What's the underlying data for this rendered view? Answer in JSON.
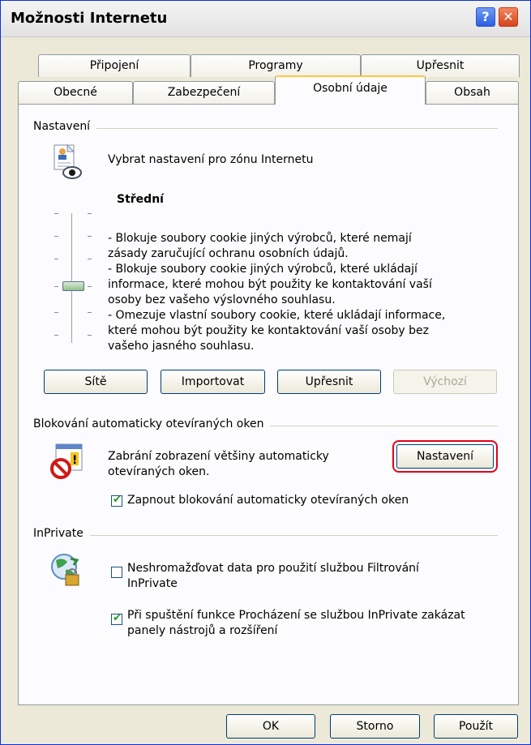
{
  "window": {
    "title": "Možnosti Internetu"
  },
  "tabs_back": [
    "Připojení",
    "Programy",
    "Upřesnit"
  ],
  "tabs_front": [
    "Obecné",
    "Zabezpečení",
    "Osobní údaje",
    "Obsah"
  ],
  "settings": {
    "group_title": "Nastavení",
    "zone_text": "Vybrat nastavení pro zónu Internetu",
    "level": "Střední",
    "desc": [
      "- Blokuje soubory cookie jiných výrobců, které nemají",
      "zásady zaručující ochranu osobních údajů.",
      "- Blokuje soubory cookie jiných výrobců, které ukládají",
      "informace, které mohou být použity ke kontaktování vaší",
      "osoby bez vašeho výslovného souhlasu.",
      "- Omezuje vlastní soubory cookie, které ukládají informace,",
      "které mohou být použity ke kontaktování vaší osoby bez",
      "vašeho jasného souhlasu."
    ],
    "buttons": [
      "Sítě",
      "Importovat",
      "Upřesnit",
      "Výchozí"
    ]
  },
  "popup": {
    "group_title": "Blokování automaticky otevíraných oken",
    "text_line1": "Zabrání zobrazení většiny automaticky",
    "text_line2": "otevíraných oken.",
    "settings_button": "Nastavení",
    "checkbox_label": "Zapnout blokování automaticky otevíraných oken",
    "checkbox_checked": true
  },
  "inprivate": {
    "group_title": "InPrivate",
    "cb1_line1": "Neshromažďovat data pro použití službou Filtrování",
    "cb1_line2": "InPrivate",
    "cb1_checked": false,
    "cb2_line1": "Při spuštění funkce Procházení se službou InPrivate zakázat",
    "cb2_line2": "panely nástrojů a rozšíření",
    "cb2_checked": true
  },
  "footer": {
    "ok": "OK",
    "cancel": "Storno",
    "apply": "Použít"
  },
  "colors": {
    "highlight_ring": "#e3001b",
    "check": "#21a121"
  }
}
